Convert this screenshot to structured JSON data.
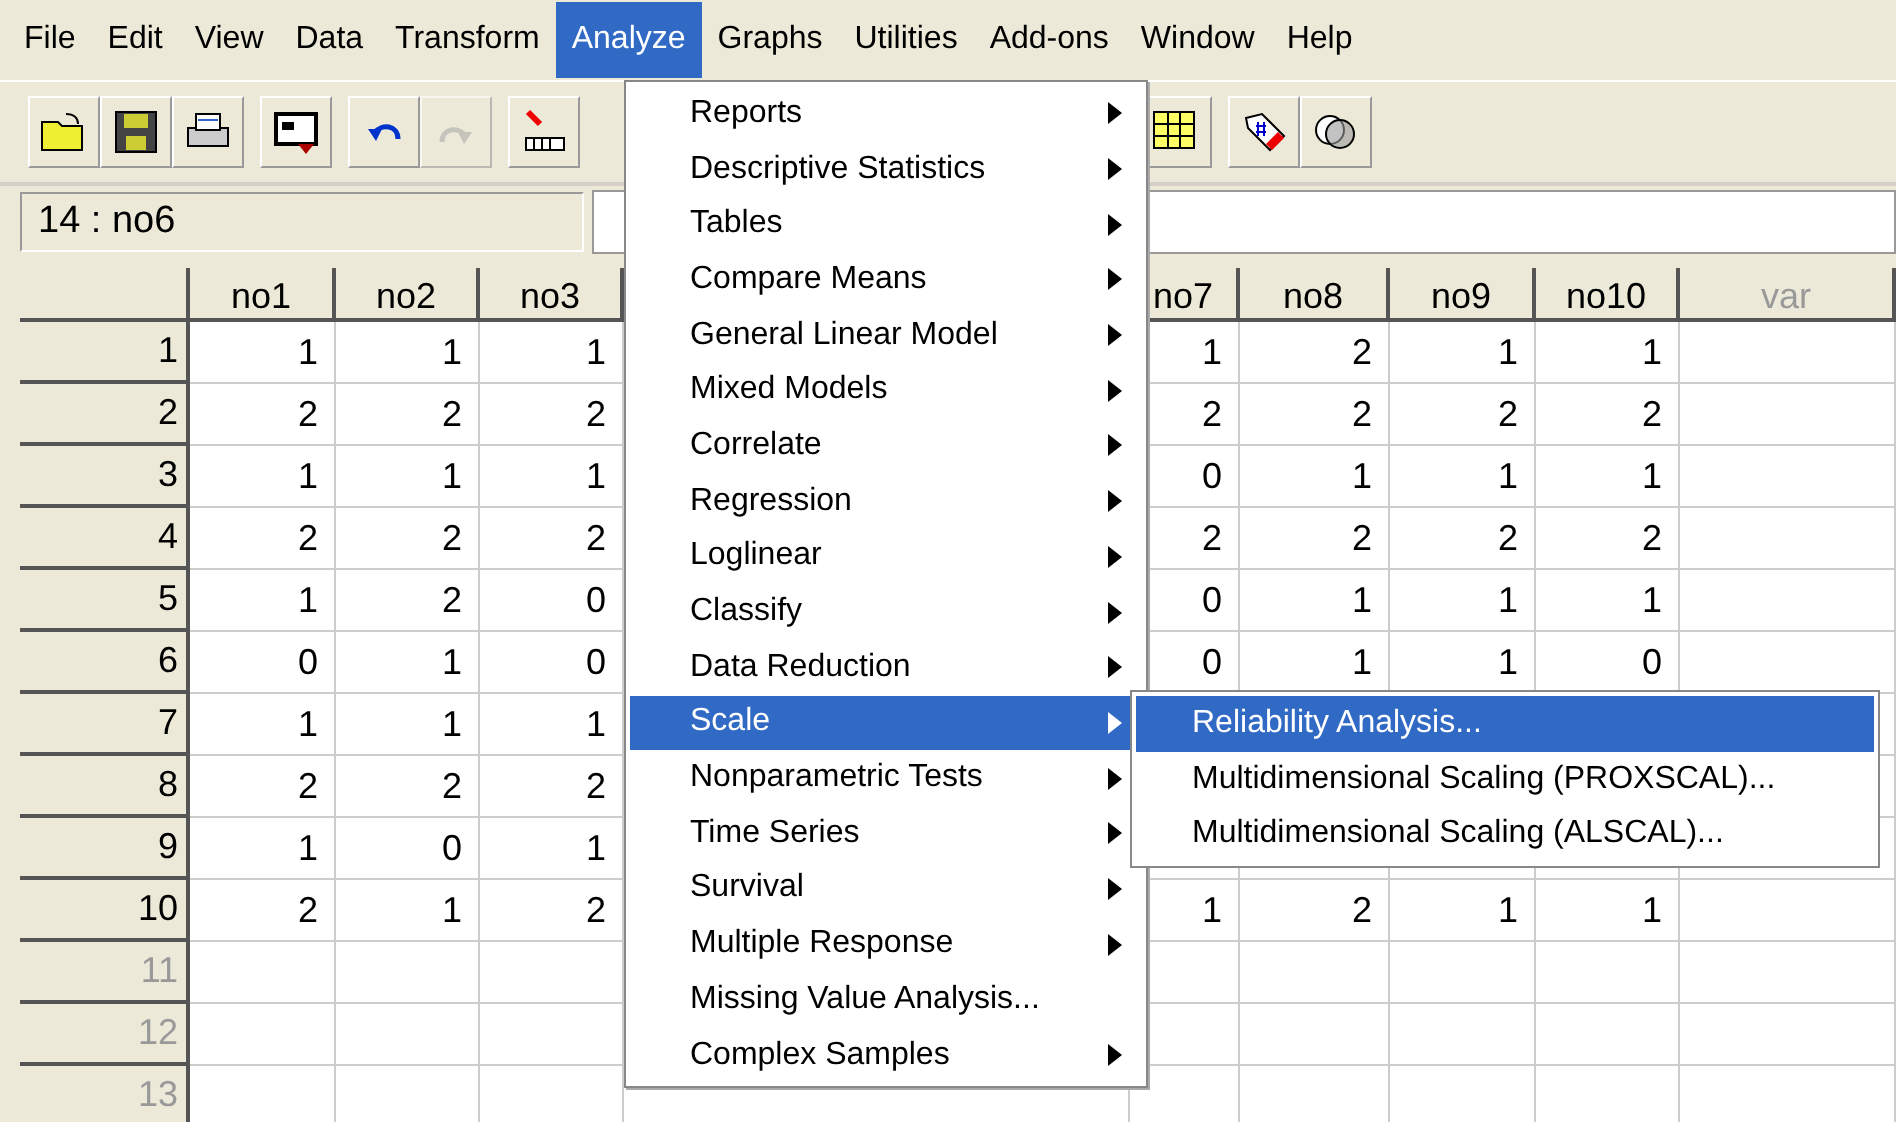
{
  "menu_bar": [
    {
      "label": "File",
      "selected": false
    },
    {
      "label": "Edit",
      "selected": false
    },
    {
      "label": "View",
      "selected": false
    },
    {
      "label": "Data",
      "selected": false
    },
    {
      "label": "Transform",
      "selected": false
    },
    {
      "label": "Analyze",
      "selected": true
    },
    {
      "label": "Graphs",
      "selected": false
    },
    {
      "label": "Utilities",
      "selected": false
    },
    {
      "label": "Add-ons",
      "selected": false
    },
    {
      "label": "Window",
      "selected": false
    },
    {
      "label": "Help",
      "selected": false
    }
  ],
  "toolbar": {
    "left_groups": [
      [
        {
          "kind": "open",
          "disabled": false
        },
        {
          "kind": "save",
          "disabled": false
        },
        {
          "kind": "print",
          "disabled": false
        }
      ],
      [
        {
          "kind": "dialog",
          "disabled": false
        }
      ],
      [
        {
          "kind": "undo",
          "disabled": false
        },
        {
          "kind": "redo",
          "disabled": true
        }
      ],
      [
        {
          "kind": "goto",
          "disabled": false
        }
      ]
    ],
    "right_groups": [
      [
        {
          "kind": "variables",
          "disabled": false
        }
      ],
      [
        {
          "kind": "labels",
          "disabled": false
        },
        {
          "kind": "sets",
          "disabled": false
        }
      ]
    ]
  },
  "cell_reference": "14 : no6",
  "table": {
    "columns": [
      {
        "label": "no1",
        "empty": false
      },
      {
        "label": "no2",
        "empty": false
      },
      {
        "label": "no3",
        "empty": false
      },
      {
        "label": "no7",
        "empty": false
      },
      {
        "label": "no8",
        "empty": false
      },
      {
        "label": "no9",
        "empty": false
      },
      {
        "label": "no10",
        "empty": false
      },
      {
        "label": "var",
        "empty": true
      }
    ],
    "rows": [
      {
        "number": "1",
        "empty": false,
        "cells": [
          "1",
          "1",
          "1",
          "1",
          "2",
          "1",
          "1"
        ]
      },
      {
        "number": "2",
        "empty": false,
        "cells": [
          "2",
          "2",
          "2",
          "2",
          "2",
          "2",
          "2"
        ]
      },
      {
        "number": "3",
        "empty": false,
        "cells": [
          "1",
          "1",
          "1",
          "0",
          "1",
          "1",
          "1"
        ]
      },
      {
        "number": "4",
        "empty": false,
        "cells": [
          "2",
          "2",
          "2",
          "2",
          "2",
          "2",
          "2"
        ]
      },
      {
        "number": "5",
        "empty": false,
        "cells": [
          "1",
          "2",
          "0",
          "0",
          "1",
          "1",
          "1"
        ]
      },
      {
        "number": "6",
        "empty": false,
        "cells": [
          "0",
          "1",
          "0",
          "0",
          "1",
          "1",
          "0"
        ]
      },
      {
        "number": "7",
        "empty": false,
        "cells": [
          "1",
          "1",
          "1",
          null,
          null,
          null,
          null
        ]
      },
      {
        "number": "8",
        "empty": false,
        "cells": [
          "2",
          "2",
          "2",
          null,
          null,
          null,
          null
        ]
      },
      {
        "number": "9",
        "empty": false,
        "cells": [
          "1",
          "0",
          "1",
          null,
          null,
          null,
          null
        ]
      },
      {
        "number": "10",
        "empty": false,
        "cells": [
          "2",
          "1",
          "2",
          "1",
          "2",
          "1",
          "1"
        ]
      },
      {
        "number": "11",
        "empty": true,
        "cells": []
      },
      {
        "number": "12",
        "empty": true,
        "cells": []
      },
      {
        "number": "13",
        "empty": true,
        "cells": []
      }
    ]
  },
  "analyze_menu": [
    {
      "label": "Reports",
      "submenu": true,
      "selected": false
    },
    {
      "label": "Descriptive Statistics",
      "submenu": true,
      "selected": false
    },
    {
      "label": "Tables",
      "submenu": true,
      "selected": false
    },
    {
      "label": "Compare Means",
      "submenu": true,
      "selected": false
    },
    {
      "label": "General Linear Model",
      "submenu": true,
      "selected": false
    },
    {
      "label": "Mixed Models",
      "submenu": true,
      "selected": false
    },
    {
      "label": "Correlate",
      "submenu": true,
      "selected": false
    },
    {
      "label": "Regression",
      "submenu": true,
      "selected": false
    },
    {
      "label": "Loglinear",
      "submenu": true,
      "selected": false
    },
    {
      "label": "Classify",
      "submenu": true,
      "selected": false
    },
    {
      "label": "Data Reduction",
      "submenu": true,
      "selected": false
    },
    {
      "label": "Scale",
      "submenu": true,
      "selected": true
    },
    {
      "label": "Nonparametric Tests",
      "submenu": true,
      "selected": false
    },
    {
      "label": "Time Series",
      "submenu": true,
      "selected": false
    },
    {
      "label": "Survival",
      "submenu": true,
      "selected": false
    },
    {
      "label": "Multiple Response",
      "submenu": true,
      "selected": false
    },
    {
      "label": "Missing Value Analysis...",
      "submenu": false,
      "selected": false
    },
    {
      "label": "Complex Samples",
      "submenu": true,
      "selected": false
    }
  ],
  "scale_submenu": [
    {
      "label": "Reliability Analysis...",
      "selected": true
    },
    {
      "label": "Multidimensional Scaling (PROXSCAL)...",
      "selected": false
    },
    {
      "label": "Multidimensional Scaling (ALSCAL)...",
      "selected": false
    }
  ]
}
